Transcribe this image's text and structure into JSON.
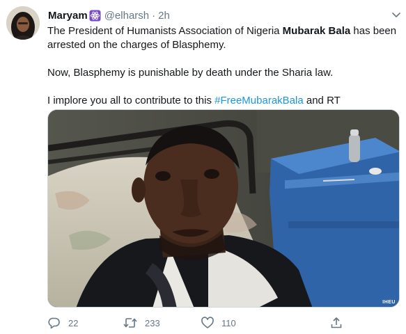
{
  "tweet": {
    "display_name": "Maryam",
    "badge_icon": "atom-symbol-icon",
    "handle": "@elharsh",
    "separator": "·",
    "time": "2h",
    "paragraph1_pre": "The President of Humanists Association of Nigeria ",
    "paragraph1_bold": "Mubarak Bala",
    "paragraph1_post": " has been arrested on the charges of Blasphemy.",
    "paragraph2": "Now, Blasphemy is punishable by death under the Sharia law.",
    "paragraph3_pre": "I implore you all to contribute to this ",
    "hashtag": "#FreeMubarakBala",
    "paragraph3_post": " and RT",
    "media_watermark": "IHEU",
    "actions": {
      "reply_count": "22",
      "retweet_count": "233",
      "like_count": "110"
    }
  },
  "icons": [
    "avatar-photo",
    "atom-symbol-icon",
    "chevron-down-icon",
    "reply-icon",
    "retweet-icon",
    "like-icon",
    "share-icon"
  ],
  "colors": {
    "text": "#14171a",
    "muted": "#657786",
    "link": "#1b95e0",
    "badge": "#794bc4",
    "border": "#ccd6dd"
  }
}
